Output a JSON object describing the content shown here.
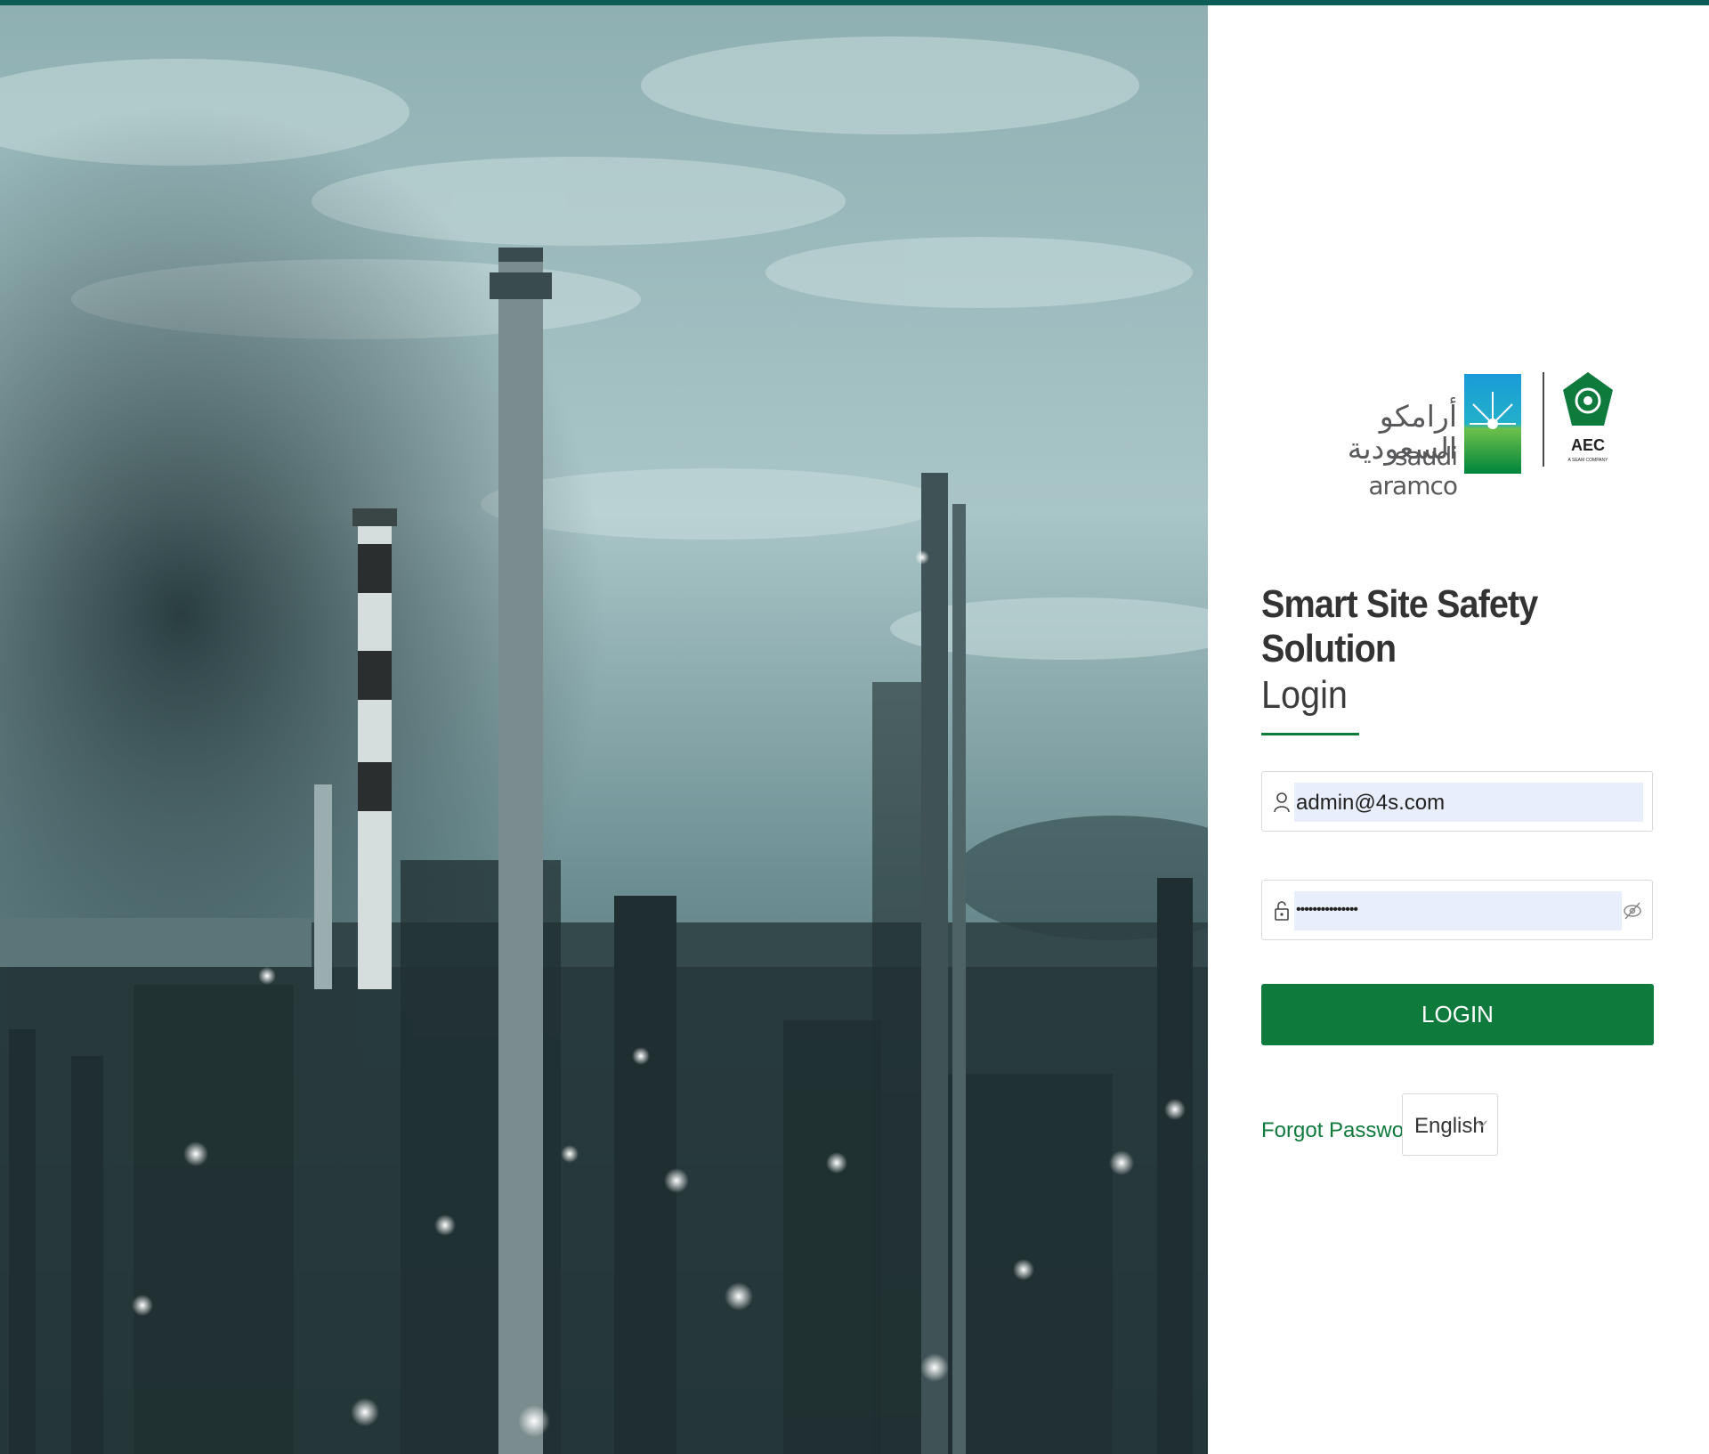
{
  "branding": {
    "aramco_arabic": "أرامكو السعودية",
    "aramco_english": "saudi aramco",
    "aec_label": "AEC",
    "aec_sub": "A SEAM COMPANY"
  },
  "app": {
    "title": "Smart Site Safety Solution"
  },
  "login": {
    "heading": "Login",
    "username_value": "admin@4s.com",
    "password_value": "•••••••••••••••",
    "submit_label": "LOGIN",
    "forgot_label": "Forgot Password ?",
    "language_selected": "English"
  },
  "icons": {
    "user": "user-icon",
    "lock": "lock-icon",
    "eye": "eye-hidden-icon",
    "chevron": "chevron-down-icon"
  },
  "colors": {
    "accent": "#0e7a3c",
    "top_strip": "#0d5d57",
    "field_fill": "#e8eefc"
  }
}
